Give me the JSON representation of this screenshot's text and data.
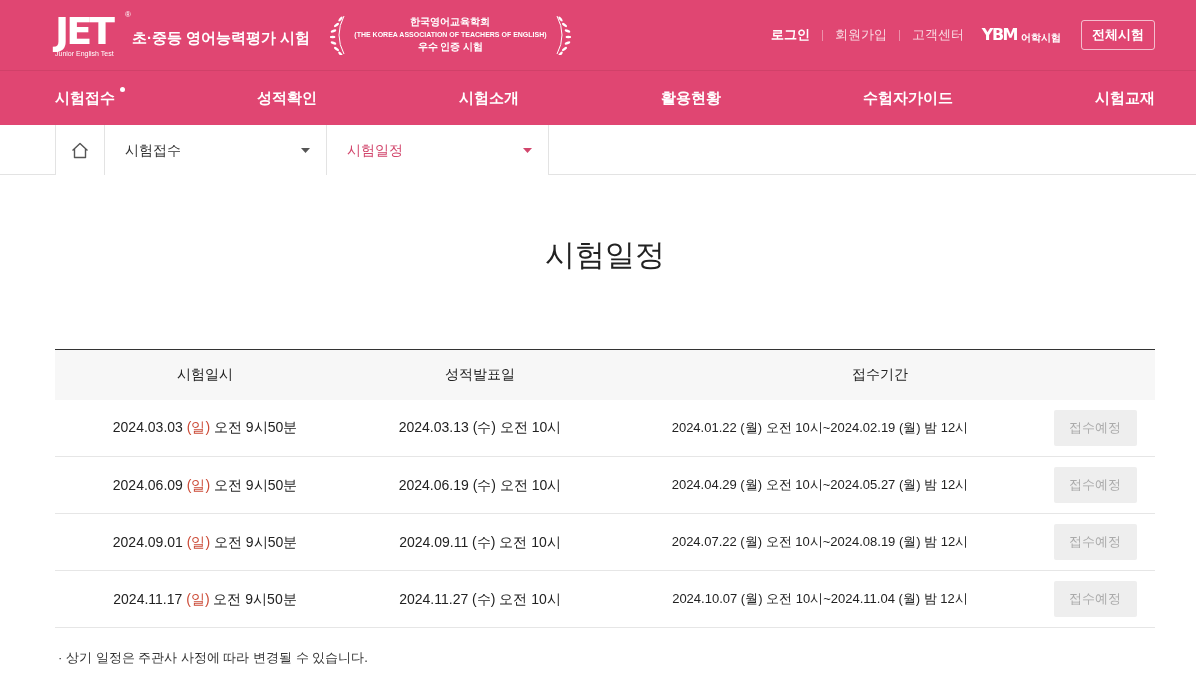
{
  "header": {
    "logo": {
      "mark": "JET",
      "registered": "®",
      "tagline": "Junior English Test"
    },
    "site_title": "초·중등 영어능력평가 시험",
    "certification": {
      "name": "한국영어교육학회",
      "english_name": "(THE KOREA ASSOCIATION OF TEACHERS OF ENGLISH)",
      "award": "우수 인증 시험"
    },
    "links": [
      {
        "label": "로그인",
        "emphasis": true
      },
      {
        "label": "회원가입",
        "emphasis": false
      },
      {
        "label": "고객센터",
        "emphasis": false
      }
    ],
    "partner_logo": {
      "mark": "YBM",
      "caption": "어학시험"
    },
    "all_exams_button": "전체시험"
  },
  "nav": [
    {
      "label": "시험접수",
      "selected": true
    },
    {
      "label": "성적확인",
      "selected": false
    },
    {
      "label": "시험소개",
      "selected": false
    },
    {
      "label": "활용현황",
      "selected": false
    },
    {
      "label": "수험자가이드",
      "selected": false
    },
    {
      "label": "시험교재",
      "selected": false
    }
  ],
  "breadcrumb": {
    "items": [
      {
        "label": "시험접수",
        "current": false
      },
      {
        "label": "시험일정",
        "current": true
      }
    ]
  },
  "page_title": "시험일정",
  "table": {
    "columns": [
      "시험일시",
      "성적발표일",
      "접수기간"
    ],
    "rows": [
      {
        "exam": {
          "date": "2024.03.03",
          "day": "(일)",
          "time": "오전 9시50분",
          "holiday": true
        },
        "result": {
          "date": "2024.03.13",
          "day": "(수)",
          "time": "오전 10시",
          "holiday": false
        },
        "period": "2024.01.22 (월) 오전 10시~2024.02.19 (월) 밤 12시",
        "status": {
          "label": "접수예정",
          "disabled": true
        }
      },
      {
        "exam": {
          "date": "2024.06.09",
          "day": "(일)",
          "time": "오전 9시50분",
          "holiday": true
        },
        "result": {
          "date": "2024.06.19",
          "day": "(수)",
          "time": "오전 10시",
          "holiday": false
        },
        "period": "2024.04.29 (월) 오전 10시~2024.05.27 (월) 밤 12시",
        "status": {
          "label": "접수예정",
          "disabled": true
        }
      },
      {
        "exam": {
          "date": "2024.09.01",
          "day": "(일)",
          "time": "오전 9시50분",
          "holiday": true
        },
        "result": {
          "date": "2024.09.11",
          "day": "(수)",
          "time": "오전 10시",
          "holiday": false
        },
        "period": "2024.07.22 (월) 오전 10시~2024.08.19 (월) 밤 12시",
        "status": {
          "label": "접수예정",
          "disabled": true
        }
      },
      {
        "exam": {
          "date": "2024.11.17",
          "day": "(일)",
          "time": "오전 9시50분",
          "holiday": true
        },
        "result": {
          "date": "2024.11.27",
          "day": "(수)",
          "time": "오전 10시",
          "holiday": false
        },
        "period": "2024.10.07 (월) 오전 10시~2024.11.04 (월) 밤 12시",
        "status": {
          "label": "접수예정",
          "disabled": true
        }
      }
    ]
  },
  "notice": "· 상기 일정은 주관사 사정에 따라 변경될 수 있습니다."
}
